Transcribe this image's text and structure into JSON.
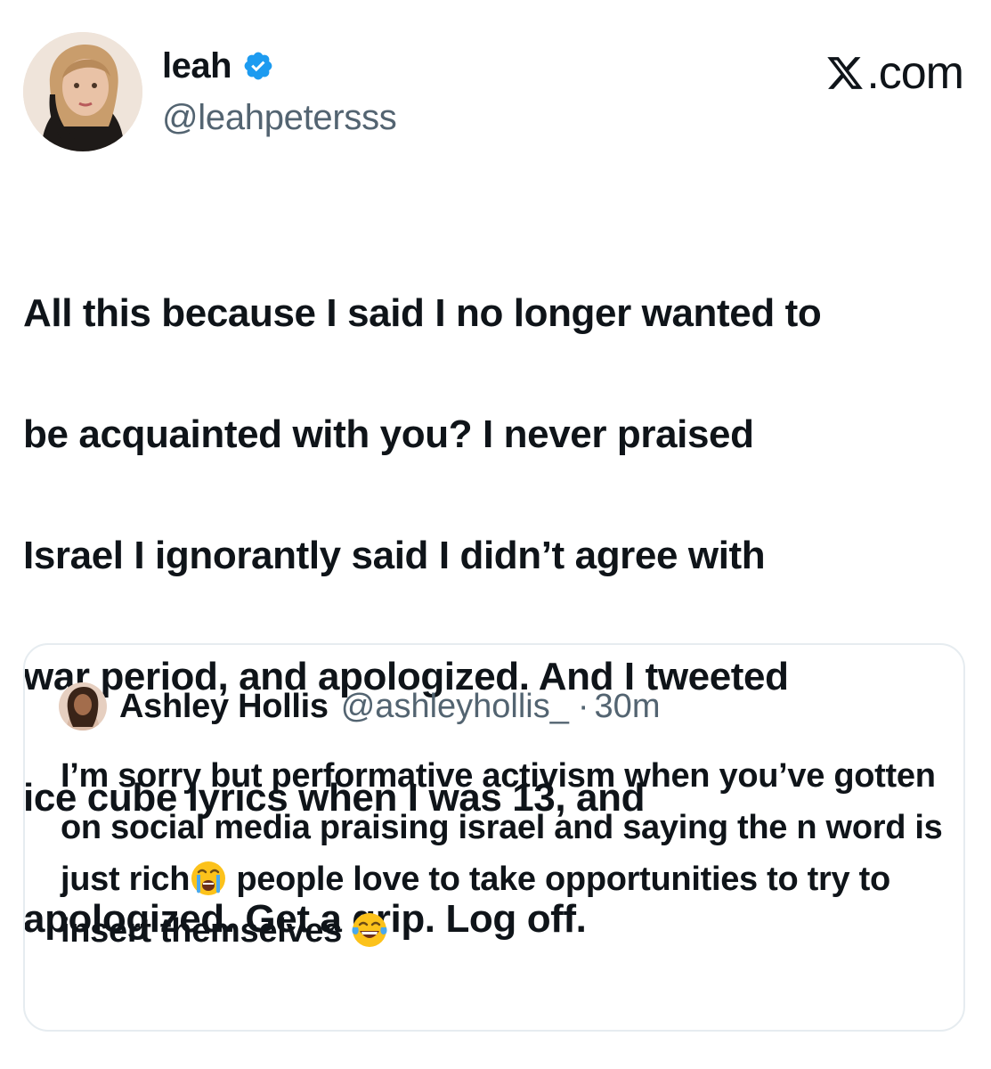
{
  "author": {
    "display_name": "leah",
    "handle": "@leahpetersss",
    "verified_icon": "verified-badge-icon",
    "avatar": "profile-photo"
  },
  "brand": {
    "label": ".com",
    "icon": "x-logo-icon"
  },
  "tweet": {
    "lines": [
      "All this because I said I no longer wanted to",
      "be acquainted with you? I never praised",
      "Israel I ignorantly said I didn’t agree with",
      "war period, and apologized. And I tweeted",
      "ice cube lyrics when I was 13, and",
      "apologized. Get a grip. Log off."
    ]
  },
  "quoted_tweet": {
    "display_name": "Ashley Hollis",
    "handle": "@ashleyhollis_",
    "separator": "·",
    "time": "30m",
    "text_part1": "I’m sorry but performative activism when you’ve gotten on social media praising israel and saying the n word is just rich",
    "emoji1": "loudly-crying-face",
    "text_part2": " people love to take opportunities to try to insert themselves ",
    "emoji2": "face-with-tears-of-joy"
  },
  "colors": {
    "text": "#0f1419",
    "secondary": "#536471",
    "verified": "#1d9bf0",
    "border": "#e6ecf0"
  }
}
